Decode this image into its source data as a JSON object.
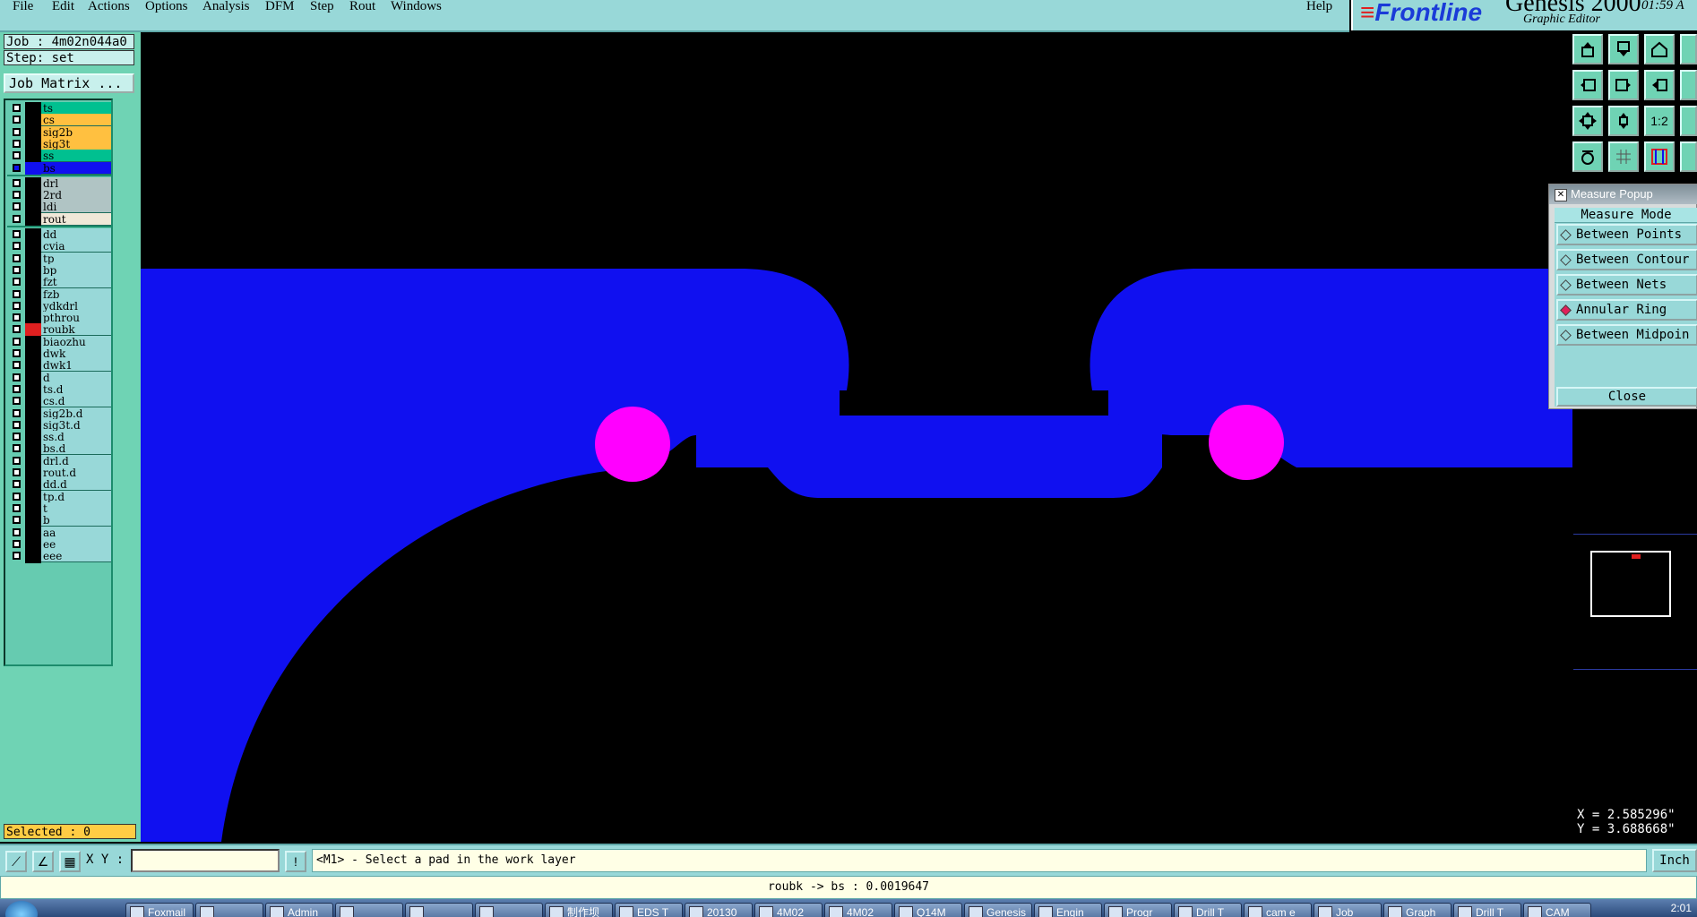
{
  "menubar": {
    "items": [
      "File",
      "Edit",
      "Actions",
      "Options",
      "Analysis",
      "DFM",
      "Step",
      "Rout",
      "Windows"
    ],
    "help": "Help"
  },
  "brand": {
    "logo": "Frontline",
    "product": "Genesis 2000",
    "subtitle": "Graphic Editor",
    "time": "01:59 A"
  },
  "left": {
    "job": "Job : 4m02n044a0",
    "step": "Step: set",
    "job_matrix": "Job Matrix ...",
    "selected": "Selected : 0",
    "layers": [
      {
        "name": "ts",
        "color": "#00c090",
        "swatch": "#000000",
        "checked": false,
        "group": 1
      },
      {
        "name": "cs",
        "color": "#ffc040",
        "swatch": "#000000",
        "checked": false,
        "group": 1
      },
      {
        "name": "sig2b",
        "color": "#ffc040",
        "swatch": "#000000",
        "checked": false,
        "group": 1
      },
      {
        "name": "sig3t",
        "color": "#ffc040",
        "swatch": "#000000",
        "checked": false,
        "group": 1
      },
      {
        "name": "ss",
        "color": "#00c090",
        "swatch": "#000000",
        "checked": false,
        "group": 1
      },
      {
        "name": "bs",
        "color": "#1010f0",
        "swatch": "#1010f0",
        "checked": true,
        "group": 1
      },
      {
        "name": "drl",
        "color": "#b0c4c4",
        "swatch": "#000000",
        "checked": false,
        "group": 2
      },
      {
        "name": "2rd",
        "color": "#b0c4c4",
        "swatch": "#000000",
        "checked": false,
        "group": 2
      },
      {
        "name": "ldi",
        "color": "#b0c4c4",
        "swatch": "#000000",
        "checked": false,
        "group": 2
      },
      {
        "name": "rout",
        "color": "#f0e8d8",
        "swatch": "#000000",
        "checked": false,
        "group": 2
      },
      {
        "name": "dd",
        "color": "#98d8d8",
        "swatch": "#000000",
        "checked": false,
        "group": 3
      },
      {
        "name": "cvia",
        "color": "#98d8d8",
        "swatch": "#000000",
        "checked": false,
        "group": 3
      },
      {
        "name": "tp",
        "color": "#98d8d8",
        "swatch": "#000000",
        "checked": false,
        "group": 3
      },
      {
        "name": "bp",
        "color": "#98d8d8",
        "swatch": "#000000",
        "checked": false,
        "group": 3
      },
      {
        "name": "fzt",
        "color": "#98d8d8",
        "swatch": "#000000",
        "checked": false,
        "group": 3
      },
      {
        "name": "fzb",
        "color": "#98d8d8",
        "swatch": "#000000",
        "checked": false,
        "group": 3
      },
      {
        "name": "ydkdrl",
        "color": "#98d8d8",
        "swatch": "#000000",
        "checked": false,
        "group": 3
      },
      {
        "name": "pthrou",
        "color": "#98d8d8",
        "swatch": "#000000",
        "checked": false,
        "group": 3
      },
      {
        "name": "roubk",
        "color": "#98d8d8",
        "swatch": "#e02020",
        "checked": false,
        "group": 3
      },
      {
        "name": "biaozhu",
        "color": "#98d8d8",
        "swatch": "#000000",
        "checked": false,
        "group": 3
      },
      {
        "name": "dwk",
        "color": "#98d8d8",
        "swatch": "#000000",
        "checked": false,
        "group": 3
      },
      {
        "name": "dwk1",
        "color": "#98d8d8",
        "swatch": "#000000",
        "checked": false,
        "group": 3
      },
      {
        "name": "d",
        "color": "#98d8d8",
        "swatch": "#000000",
        "checked": false,
        "group": 3
      },
      {
        "name": "ts.d",
        "color": "#98d8d8",
        "swatch": "#000000",
        "checked": false,
        "group": 3
      },
      {
        "name": "cs.d",
        "color": "#98d8d8",
        "swatch": "#000000",
        "checked": false,
        "group": 3
      },
      {
        "name": "sig2b.d",
        "color": "#98d8d8",
        "swatch": "#000000",
        "checked": false,
        "group": 3
      },
      {
        "name": "sig3t.d",
        "color": "#98d8d8",
        "swatch": "#000000",
        "checked": false,
        "group": 3
      },
      {
        "name": "ss.d",
        "color": "#98d8d8",
        "swatch": "#000000",
        "checked": false,
        "group": 3
      },
      {
        "name": "bs.d",
        "color": "#98d8d8",
        "swatch": "#000000",
        "checked": false,
        "group": 3
      },
      {
        "name": "drl.d",
        "color": "#98d8d8",
        "swatch": "#000000",
        "checked": false,
        "group": 3
      },
      {
        "name": "rout.d",
        "color": "#98d8d8",
        "swatch": "#000000",
        "checked": false,
        "group": 3
      },
      {
        "name": "dd.d",
        "color": "#98d8d8",
        "swatch": "#000000",
        "checked": false,
        "group": 3
      },
      {
        "name": "tp.d",
        "color": "#98d8d8",
        "swatch": "#000000",
        "checked": false,
        "group": 3
      },
      {
        "name": "t",
        "color": "#98d8d8",
        "swatch": "#000000",
        "checked": false,
        "group": 3
      },
      {
        "name": "b",
        "color": "#98d8d8",
        "swatch": "#000000",
        "checked": false,
        "group": 3
      },
      {
        "name": "aa",
        "color": "#98d8d8",
        "swatch": "#000000",
        "checked": false,
        "group": 3
      },
      {
        "name": "ee",
        "color": "#98d8d8",
        "swatch": "#000000",
        "checked": false,
        "group": 3
      },
      {
        "name": "eee",
        "color": "#98d8d8",
        "swatch": "#000000",
        "checked": false,
        "group": 3
      }
    ]
  },
  "canvas": {
    "copper_color": "#1010f0",
    "pad_color": "#ff00ff",
    "background": "#000000"
  },
  "tools": {
    "icons": [
      "open-up-icon",
      "save-down-icon",
      "home-icon",
      "zoom-left-icon",
      "zoom-right-icon",
      "zoom-fit-icon",
      "fit-screen-icon",
      "zoom-center-icon",
      "scale-1-2-icon",
      "snap-icon",
      "grid-icon",
      "layers-icon"
    ],
    "scale_label": "1:2"
  },
  "measure": {
    "title": "Measure Popup",
    "mode_label": "Measure Mode",
    "options": [
      {
        "label": "Between Points",
        "selected": false
      },
      {
        "label": "Between Contour",
        "selected": false
      },
      {
        "label": "Between Nets",
        "selected": false
      },
      {
        "label": "Annular Ring",
        "selected": true
      },
      {
        "label": "Between Midpoin",
        "selected": false
      }
    ],
    "close": "Close"
  },
  "coords": {
    "x": "X = 2.585296\"",
    "y": "Y = 3.688668\""
  },
  "cmd": {
    "xy_label": "X Y :",
    "xy_value": "",
    "prompt": "<M1> - Select a pad in the work layer",
    "units": "Inch"
  },
  "status": {
    "text": "roubk -> bs : 0.0019647"
  },
  "taskbar": {
    "tasks": [
      "Foxmail",
      "",
      "Admin",
      "",
      "",
      "",
      "制作坝",
      "EDS T",
      "20130",
      "4M02",
      "4M02",
      "Q14M",
      "Genesis",
      "Engin",
      "Progr",
      "Drill T",
      "cam e",
      "Job",
      "Graph",
      "Drill T",
      "CAM"
    ],
    "clock": "2:01"
  }
}
